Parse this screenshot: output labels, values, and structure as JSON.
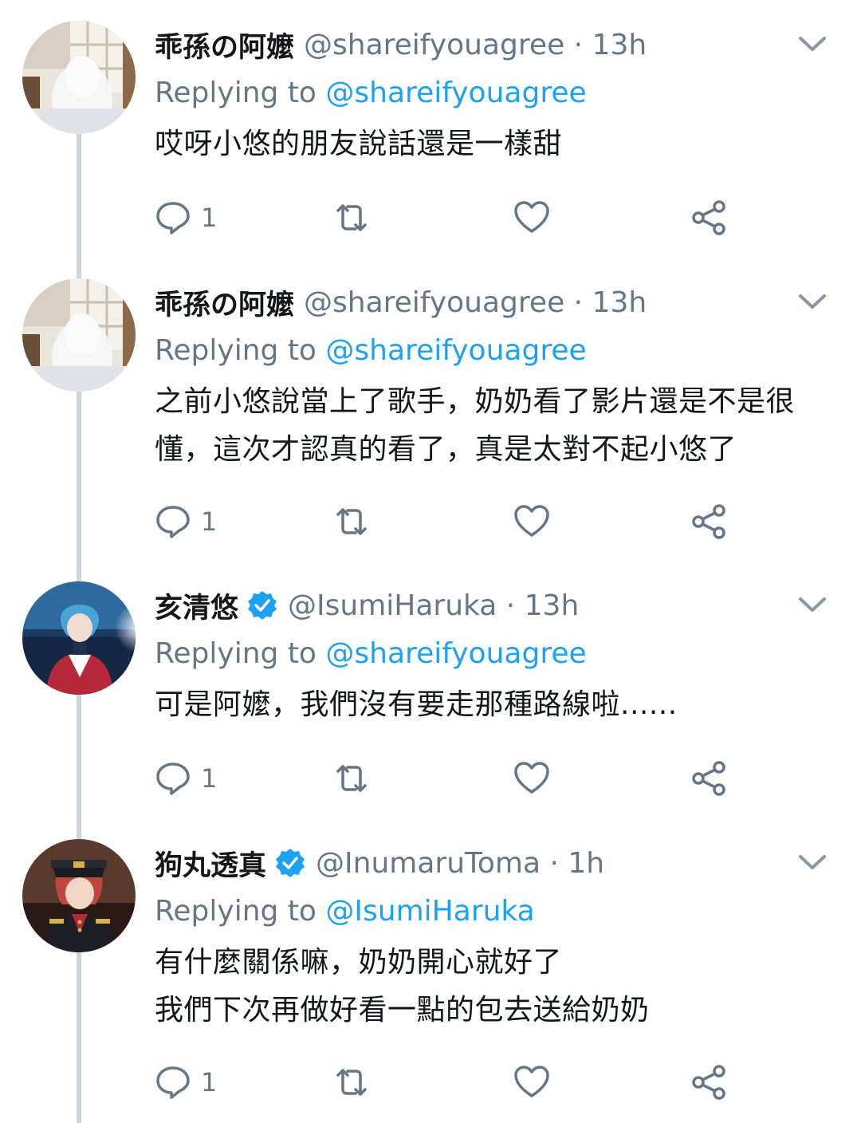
{
  "colors": {
    "accent": "#1da1f2",
    "secondary": "#657786",
    "line": "#ccd6dd"
  },
  "replying_label": "Replying to",
  "tweets": [
    {
      "name": "乖孫の阿嬤",
      "handle": "@shareifyouagree",
      "time": "13h",
      "verified": false,
      "replying_to": "@shareifyouagree",
      "lines": [
        "哎呀小悠的朋友說話還是一樣甜"
      ],
      "reply_count": "1",
      "avatar_icon": "grandma-avatar"
    },
    {
      "name": "乖孫の阿嬤",
      "handle": "@shareifyouagree",
      "time": "13h",
      "verified": false,
      "replying_to": "@shareifyouagree",
      "lines": [
        "之前小悠說當上了歌手，奶奶看了影片還是不是很",
        "懂，這次才認真的看了，真是太對不起小悠了"
      ],
      "reply_count": "1",
      "avatar_icon": "grandma-avatar"
    },
    {
      "name": "亥清悠",
      "handle": "@IsumiHaruka",
      "time": "13h",
      "verified": true,
      "replying_to": "@shareifyouagree",
      "lines": [
        "可是阿嬤，我們沒有要走那種路線啦......"
      ],
      "reply_count": "1",
      "avatar_icon": "haruka-avatar"
    },
    {
      "name": "狗丸透真",
      "handle": "@InumaruToma",
      "time": "1h",
      "verified": true,
      "replying_to": "@IsumiHaruka",
      "lines": [
        "有什麼關係嘛，奶奶開心就好了",
        "我們下次再做好看一點的包去送給奶奶"
      ],
      "reply_count": "1",
      "avatar_icon": "toma-avatar"
    }
  ]
}
